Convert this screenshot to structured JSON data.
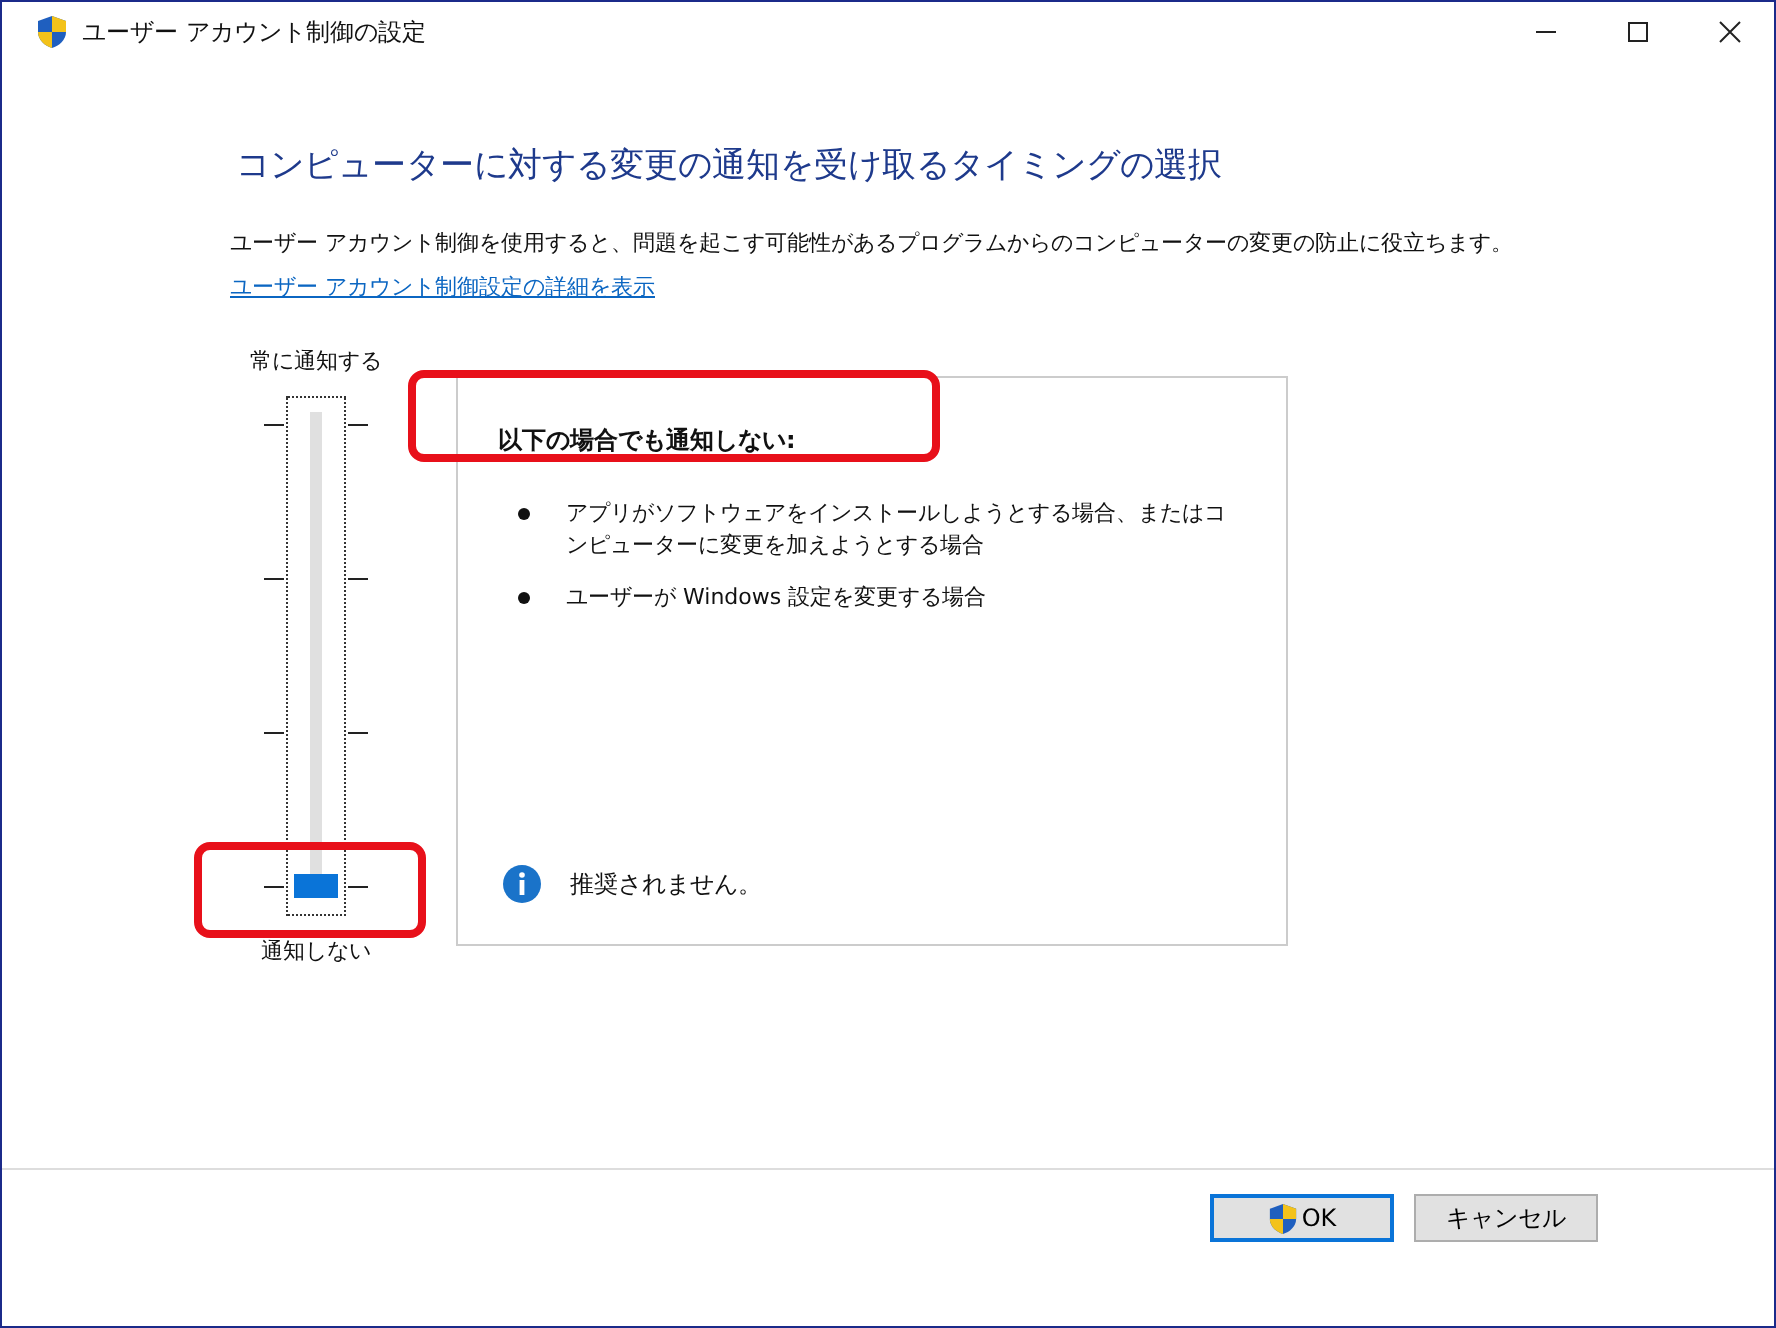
{
  "window": {
    "title": "ユーザー アカウント制御の設定"
  },
  "heading": "コンピューターに対する変更の通知を受け取るタイミングの選択",
  "description": "ユーザー アカウント制御を使用すると、問題を起こす可能性があるプログラムからのコンピューターの変更の防止に役立ちます。",
  "details_link": "ユーザー アカウント制御設定の詳細を表示",
  "slider": {
    "top_label": "常に通知する",
    "bottom_label": "通知しない",
    "level": 0,
    "highlighted": true
  },
  "panel": {
    "title": "以下の場合でも通知しない:",
    "title_highlighted": true,
    "bullets": [
      "アプリがソフトウェアをインストールしようとする場合、またはコンピューターに変更を加えようとする場合",
      "ユーザーが Windows 設定を変更する場合"
    ],
    "note": "推奨されません。"
  },
  "buttons": [
    {
      "label": "OK",
      "kind": "shield"
    },
    {
      "label": "キャンセル",
      "kind": "plain"
    }
  ]
}
